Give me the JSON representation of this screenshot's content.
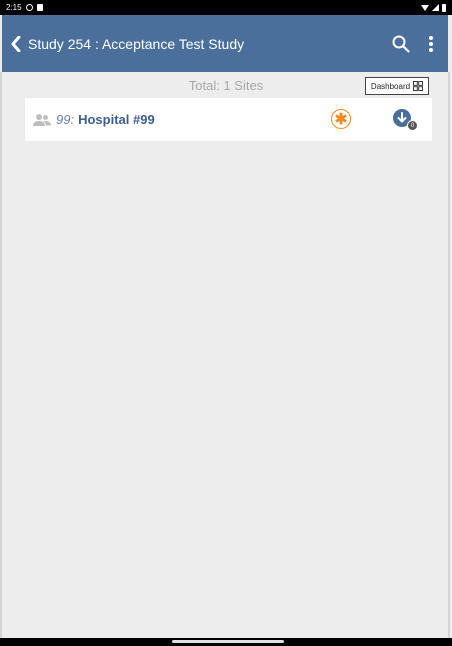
{
  "status_bar": {
    "time": "2:15"
  },
  "app_bar": {
    "title": "Study 254 : Acceptance Test Study",
    "color": "#4b6f9b"
  },
  "summary": {
    "total_label": "Total: 1 Sites"
  },
  "dashboard": {
    "label": "Dashboard",
    "icon": "grid-icon"
  },
  "sites": [
    {
      "number": "99",
      "separator": ":",
      "name": "Hospital #99",
      "status_icon": "asterisk-icon",
      "status_color": "#f08a24",
      "download_icon": "download-icon",
      "download_badge": "0"
    }
  ],
  "colors": {
    "accent": "#4b6f9b",
    "background": "#ededed",
    "site_name": "#3a5e8e"
  }
}
